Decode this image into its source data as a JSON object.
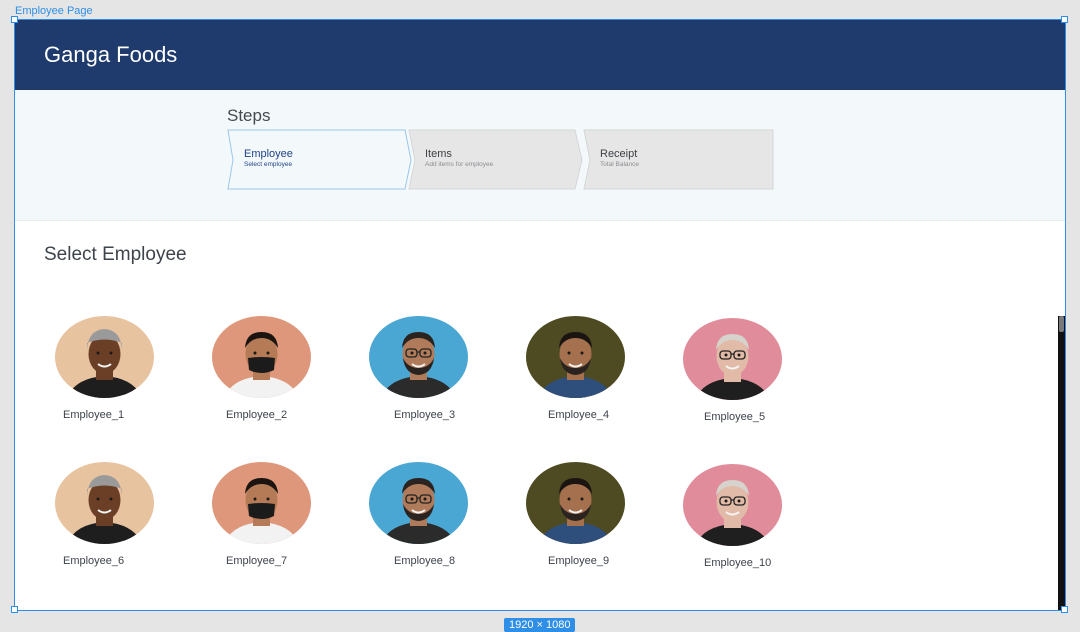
{
  "canvas": {
    "frame_label": "Employee Page",
    "size_badge": "1920 × 1080"
  },
  "header": {
    "title": "Ganga Foods"
  },
  "steps": {
    "title": "Steps",
    "items": [
      {
        "title": "Employee",
        "subtitle": "Select employee",
        "state": "active"
      },
      {
        "title": "Items",
        "subtitle": "Add items for employee",
        "state": "inactive"
      },
      {
        "title": "Receipt",
        "subtitle": "Total Balance",
        "state": "inactive"
      }
    ]
  },
  "main": {
    "section_title": "Select Employee",
    "employees": [
      {
        "name": "Employee_1"
      },
      {
        "name": "Employee_2"
      },
      {
        "name": "Employee_3"
      },
      {
        "name": "Employee_4"
      },
      {
        "name": "Employee_5"
      },
      {
        "name": "Employee_6"
      },
      {
        "name": "Employee_7"
      },
      {
        "name": "Employee_8"
      },
      {
        "name": "Employee_9"
      },
      {
        "name": "Employee_10"
      }
    ]
  },
  "colors": {
    "header_bg": "#1f3a6c",
    "accent": "#2f8ee5",
    "step_active_bg": "#f3f8fb",
    "step_inactive_bg": "#e6e6e6"
  }
}
